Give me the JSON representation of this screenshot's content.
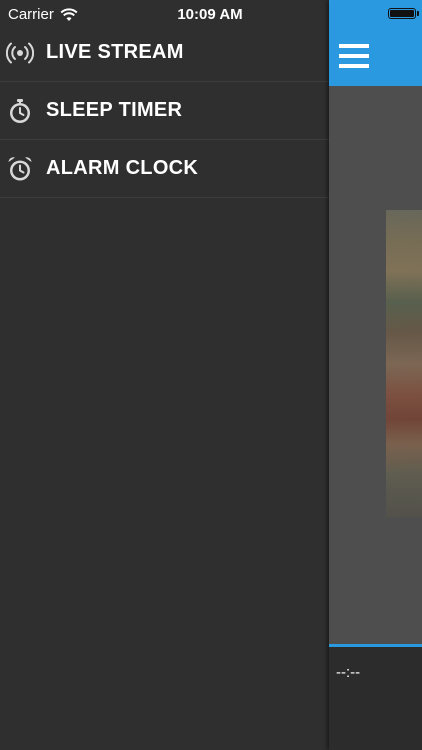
{
  "status_bar": {
    "carrier": "Carrier",
    "time": "10:09 AM",
    "battery_level": 1.0
  },
  "side_menu": {
    "items": [
      {
        "label": "LIVE STREAM",
        "icon": "broadcast-icon"
      },
      {
        "label": "SLEEP TIMER",
        "icon": "stopwatch-icon"
      },
      {
        "label": "ALARM CLOCK",
        "icon": "alarm-clock-icon"
      }
    ]
  },
  "main": {
    "nav_icon": "hamburger-menu-icon",
    "player": {
      "time": "--:--"
    }
  },
  "colors": {
    "accent": "#2a99e0",
    "menu_background": "#2f2f2f",
    "text": "#ffffff"
  }
}
